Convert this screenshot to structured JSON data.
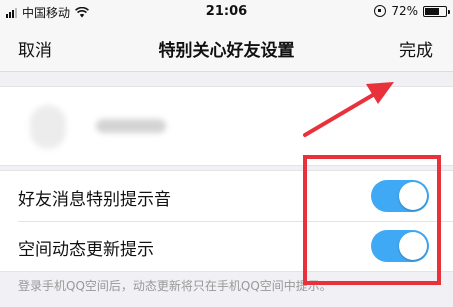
{
  "status_bar": {
    "carrier": "中国移动",
    "time": "21:06",
    "battery_percent": "72%",
    "battery_level": 0.72
  },
  "nav": {
    "cancel_label": "取消",
    "title": "特别关心好友设置",
    "done_label": "完成"
  },
  "settings": [
    {
      "label": "好友消息特别提示音",
      "enabled": true
    },
    {
      "label": "空间动态更新提示",
      "enabled": true
    }
  ],
  "footnote": "登录手机QQ空间后，动态更新将只在手机QQ空间中提示。",
  "colors": {
    "switch_on": "#3fa9f5",
    "annotation": "#e8313b"
  }
}
